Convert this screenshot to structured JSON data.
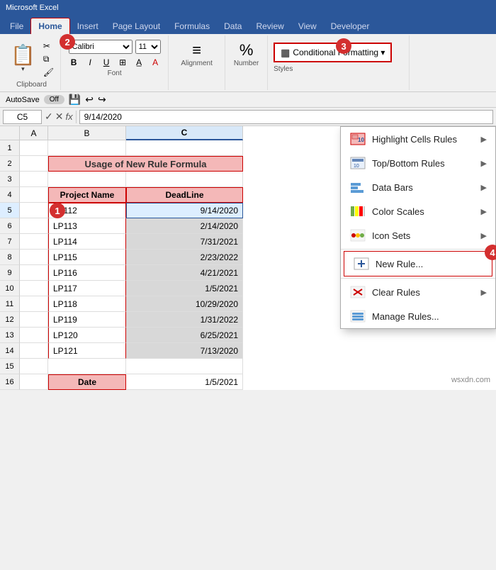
{
  "titleBar": {
    "text": "Microsoft Excel"
  },
  "ribbonTabs": [
    {
      "label": "File",
      "active": false
    },
    {
      "label": "Home",
      "active": true
    },
    {
      "label": "Insert",
      "active": false
    },
    {
      "label": "Page Layout",
      "active": false
    },
    {
      "label": "Formulas",
      "active": false
    },
    {
      "label": "Data",
      "active": false
    },
    {
      "label": "Review",
      "active": false
    },
    {
      "label": "View",
      "active": false
    },
    {
      "label": "Developer",
      "active": false
    }
  ],
  "ribbon": {
    "fontName": "Calibri",
    "fontSize": "11",
    "clipboardLabel": "Clipboard",
    "fontLabel": "Font",
    "alignmentLabel": "Alignment",
    "numberLabel": "Number",
    "cfButton": "Conditional Formatting ▾",
    "badge2": "2",
    "badge3": "3"
  },
  "formulaBar": {
    "cellRef": "C5",
    "formula": "9/14/2020"
  },
  "columns": [
    "A",
    "B",
    "C"
  ],
  "rows": [
    {
      "num": "1",
      "a": "",
      "b": "",
      "c": ""
    },
    {
      "num": "2",
      "a": "",
      "b": "Usage of New Rule Formula",
      "c": "",
      "titleRow": true
    },
    {
      "num": "3",
      "a": "",
      "b": "",
      "c": ""
    },
    {
      "num": "4",
      "a": "",
      "b": "Project Name",
      "c": "DeadLine",
      "headerRow": true
    },
    {
      "num": "5",
      "a": "",
      "b": "LP112",
      "c": "9/14/2020",
      "selected": true
    },
    {
      "num": "6",
      "a": "",
      "b": "LP113",
      "c": "2/14/2020",
      "gray": true
    },
    {
      "num": "7",
      "a": "",
      "b": "LP114",
      "c": "7/31/2021",
      "gray": true
    },
    {
      "num": "8",
      "a": "",
      "b": "LP115",
      "c": "2/23/2022",
      "gray": true
    },
    {
      "num": "9",
      "a": "",
      "b": "LP116",
      "c": "4/21/2021",
      "gray": true
    },
    {
      "num": "10",
      "a": "",
      "b": "LP117",
      "c": "1/5/2021",
      "gray": true
    },
    {
      "num": "11",
      "a": "",
      "b": "LP118",
      "c": "10/29/2020",
      "gray": true
    },
    {
      "num": "12",
      "a": "",
      "b": "LP119",
      "c": "1/31/2022",
      "gray": true
    },
    {
      "num": "13",
      "a": "",
      "b": "LP120",
      "c": "6/25/2021",
      "gray": true
    },
    {
      "num": "14",
      "a": "",
      "b": "LP121",
      "c": "7/13/2020",
      "gray": true
    },
    {
      "num": "15",
      "a": "",
      "b": "",
      "c": ""
    },
    {
      "num": "16",
      "a": "",
      "b": "Date",
      "c": "1/5/2021",
      "dateRow": true
    }
  ],
  "menu": {
    "items": [
      {
        "id": "highlight-cells",
        "label": "Highlight Cells Rules",
        "arrow": true
      },
      {
        "id": "top-bottom",
        "label": "Top/Bottom Rules",
        "arrow": true
      },
      {
        "id": "data-bars",
        "label": "Data Bars",
        "arrow": true
      },
      {
        "id": "color-scales",
        "label": "Color Scales",
        "arrow": true
      },
      {
        "id": "icon-sets",
        "label": "Icon Sets",
        "arrow": true
      },
      {
        "id": "divider1"
      },
      {
        "id": "new-rule",
        "label": "New Rule...",
        "highlighted": true
      },
      {
        "id": "divider2"
      },
      {
        "id": "clear-rules",
        "label": "Clear Rules",
        "arrow": true
      },
      {
        "id": "manage-rules",
        "label": "Manage Rules..."
      }
    ]
  },
  "badge1": "1",
  "badge4": "4",
  "watermark": "wsxdn.com"
}
